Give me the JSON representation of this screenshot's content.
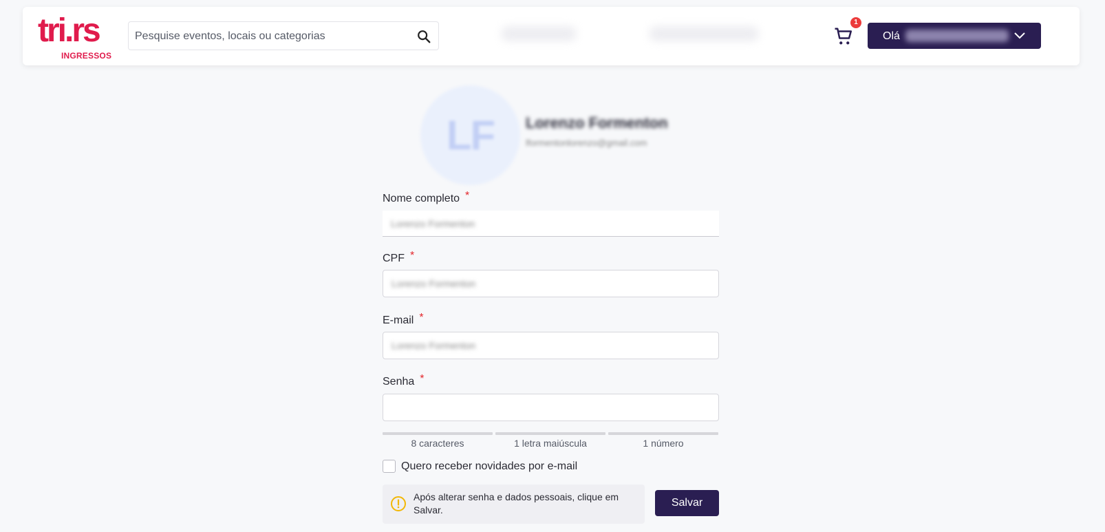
{
  "header": {
    "logo_main": "tri.rs",
    "logo_sub": "INGRESSOS",
    "search_placeholder": "Pesquise eventos, locais ou categorias",
    "cart_count": "1",
    "greeting": "Olá"
  },
  "profile": {
    "initials": "LF",
    "name": "Lorenzo Formenton",
    "email": "lformentonlorenzo@gmail.com"
  },
  "form": {
    "name_label": "Nome completo",
    "name_value": "Lorenzo Formenton",
    "cpf_label": "CPF",
    "cpf_value": "Lorenzo Formenton",
    "email_label": "E-mail",
    "email_value": "Lorenzo Formenton",
    "password_label": "Senha",
    "required_mark": "*",
    "strength": [
      "8 caracteres",
      "1 letra maiúscula",
      "1 número"
    ],
    "newsletter_label": "Quero receber novidades por e-mail",
    "notice_text": "Após alterar senha e dados pessoais, clique em Salvar.",
    "save_label": "Salvar"
  },
  "colors": {
    "brand_red": "#e01b4c",
    "primary_dark": "#2a1e52",
    "required_red": "#e3262b",
    "warning_yellow": "#f2b705"
  },
  "icons": [
    "search-icon",
    "cart-icon",
    "chevron-down-icon",
    "warning-icon"
  ]
}
